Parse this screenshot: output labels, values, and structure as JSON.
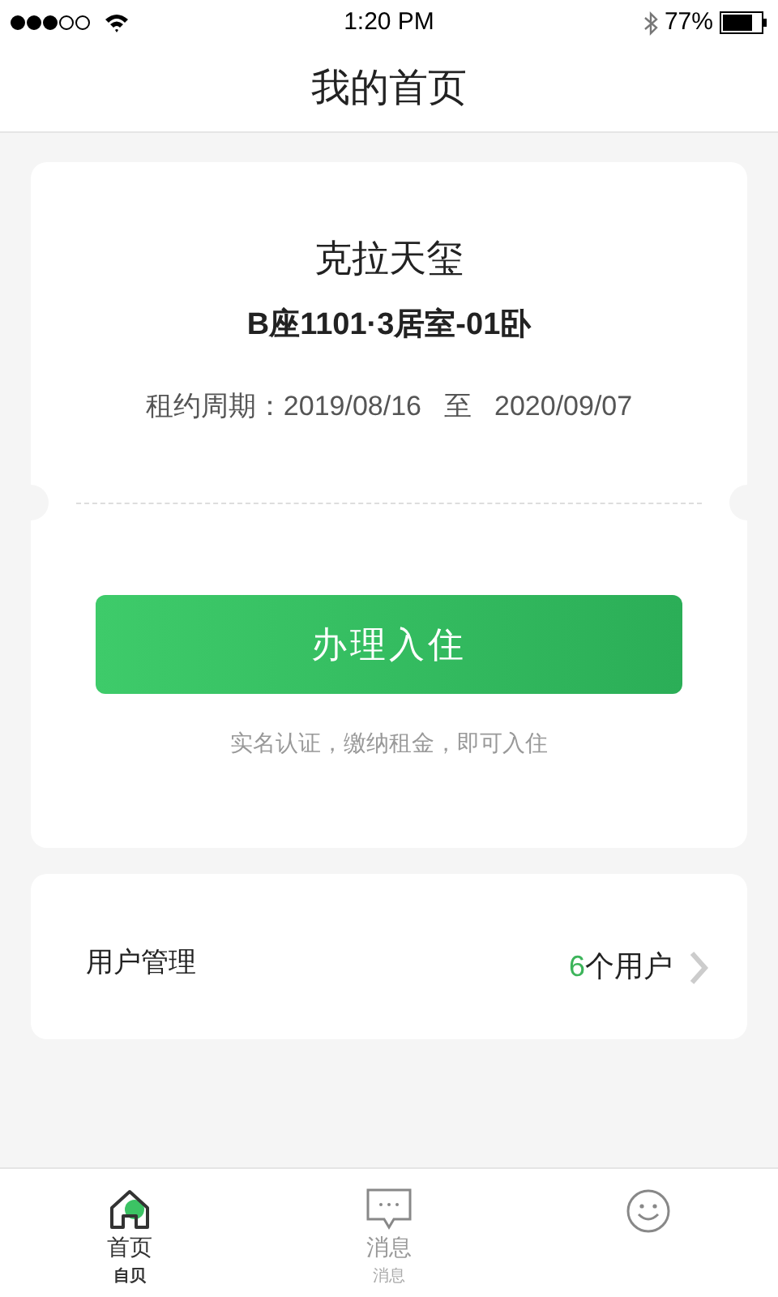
{
  "status_bar": {
    "time": "1:20 PM",
    "battery": "77%"
  },
  "header": {
    "title": "我的首页"
  },
  "lease_card": {
    "name": "克拉天玺",
    "room": "B座1101·3居室-01卧",
    "period_label": "租约周期：",
    "start": "2019/08/16",
    "to": "至",
    "end": "2020/09/07",
    "button": "办理入住",
    "hint": "实名认证，缴纳租金，即可入住"
  },
  "user_row": {
    "label": "用户管理",
    "count": "6",
    "unit": "个用户"
  },
  "tabs": [
    {
      "kind": "home",
      "label": "首页",
      "sublabel": "自贝",
      "selected": true
    },
    {
      "kind": "message",
      "label": "消息",
      "sublabel": "消息",
      "selected": false
    },
    {
      "kind": "smile",
      "selected": false
    }
  ]
}
